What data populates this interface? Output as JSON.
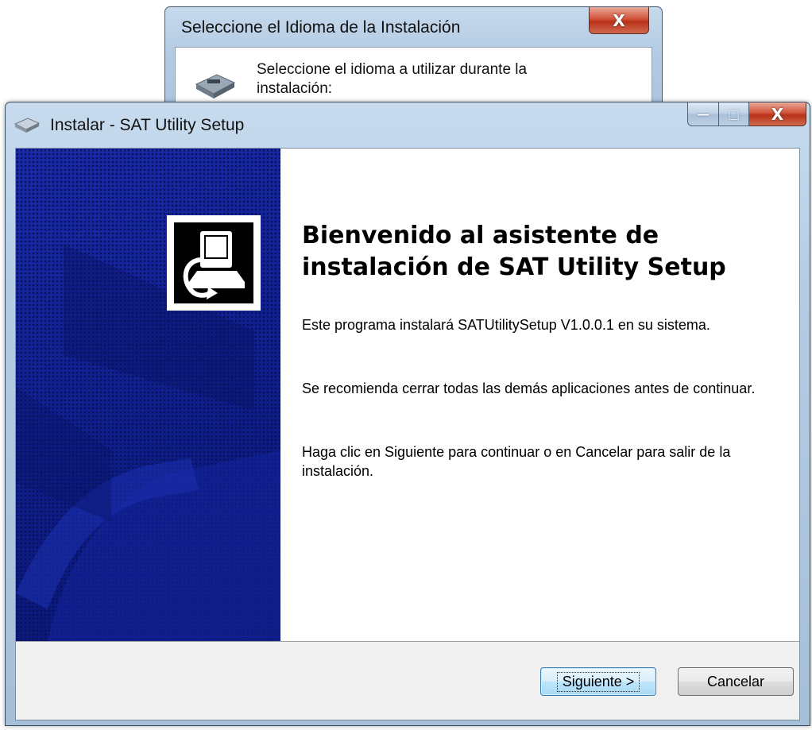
{
  "language_dialog": {
    "title": "Seleccione el Idioma de la Instalación",
    "prompt": "Seleccione el idioma a utilizar durante la instalación:",
    "icon": "installer-disk-icon",
    "close_glyph": "X"
  },
  "installer": {
    "title": "Instalar - SAT Utility Setup",
    "app_icon": "installer-app-icon",
    "caption": {
      "minimize": "—",
      "maximize": "□",
      "close": "X"
    },
    "banner_icon": "computer-install-icon",
    "heading": "Bienvenido al asistente de instalación de SAT Utility Setup",
    "paragraphs": [
      "Este programa instalará SATUtilitySetup V1.0.0.1 en su sistema.",
      "Se recomienda cerrar todas las demás aplicaciones antes de continuar.",
      "Haga clic en Siguiente para continuar o en Cancelar para salir de la instalación."
    ],
    "buttons": {
      "next": "Siguiente >",
      "cancel": "Cancelar"
    }
  },
  "colors": {
    "banner": "#0e1a78",
    "aero_frame": "#b4cce4",
    "close_red": "#c9442a"
  }
}
